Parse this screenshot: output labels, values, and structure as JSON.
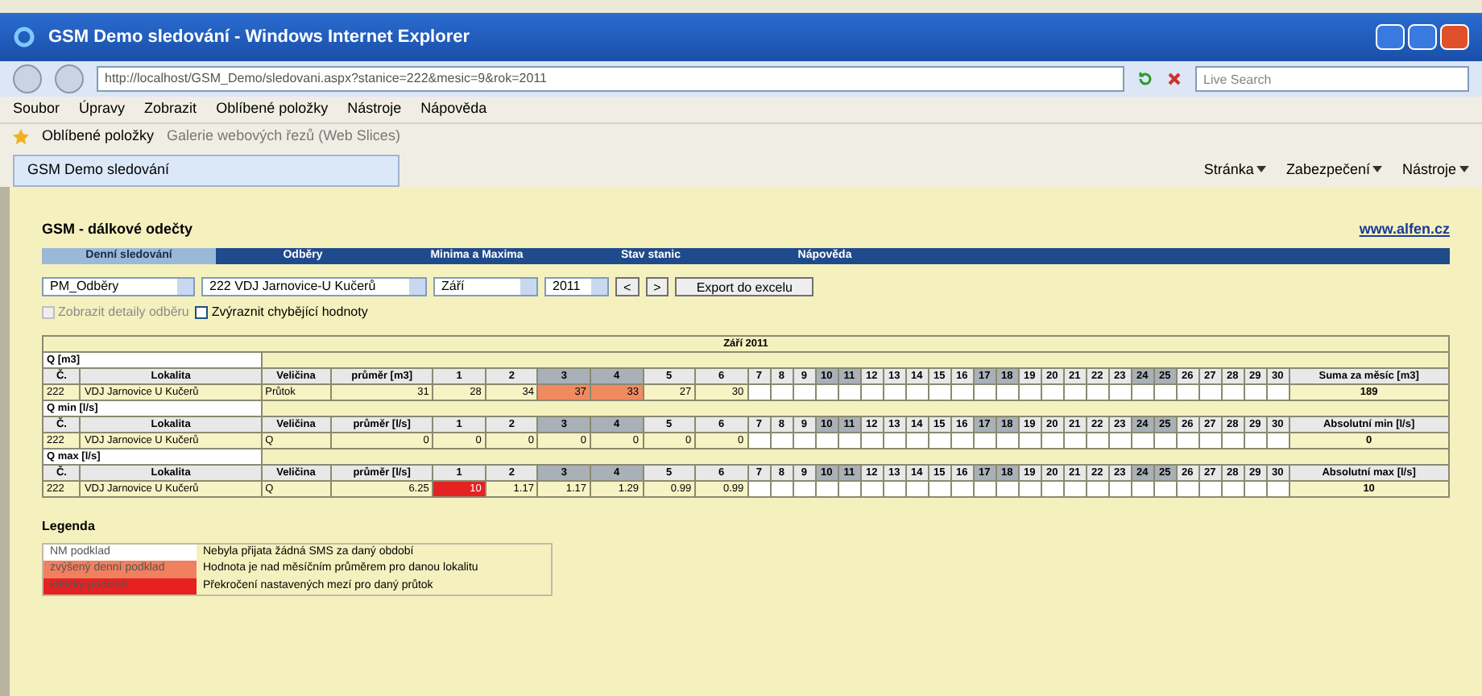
{
  "window": {
    "title": "GSM Demo sledování - Windows Internet Explorer"
  },
  "address_bar": {
    "url": "http://localhost/GSM_Demo/sledovani.aspx?stanice=222&mesic=9&rok=2011"
  },
  "search": {
    "placeholder": "Live Search"
  },
  "menu": [
    "Soubor",
    "Úpravy",
    "Zobrazit",
    "Oblíbené položky",
    "Nástroje",
    "Nápověda"
  ],
  "favorites_bar": {
    "label": "Oblíbené položky",
    "items": [
      "Galerie webových řezů (Web Slices)"
    ]
  },
  "browser_tab": {
    "title": "GSM Demo sledování"
  },
  "command_bar": [
    "Stránka",
    "Zabezpečení",
    "Nástroje"
  ],
  "page": {
    "title": "GSM - dálkové odečty",
    "link": "www.alfen.cz",
    "nav": [
      {
        "label": "Denní sledování",
        "selected": true
      },
      {
        "label": "Odběry",
        "selected": false
      },
      {
        "label": "Minima a Maxima",
        "selected": false
      },
      {
        "label": "Stav stanic",
        "selected": false
      },
      {
        "label": "Nápověda",
        "selected": false
      }
    ],
    "filters": [
      {
        "value": "PM_Odběry"
      },
      {
        "value": "222 VDJ Jarnovice-U Kučerů"
      },
      {
        "value": "Září"
      },
      {
        "value": "2011"
      }
    ],
    "prev_button": "<",
    "next_button": ">",
    "export_button": "Export do excelu",
    "options": [
      {
        "label": "Zobrazit detaily odběru",
        "checked": false,
        "disabled": true
      },
      {
        "label": "Zvýraznit chybějící hodnoty",
        "checked": false,
        "disabled": false
      }
    ],
    "table": {
      "caption": "Září 2011",
      "sections": [
        {
          "title": "Q [m3]",
          "columns": [
            "Č.",
            "Lokalita",
            "Veličina",
            "průměr [m3]"
          ],
          "total_header": "Suma za měsíc [m3]",
          "days": [
            {
              "label": "1",
              "weekend": false
            },
            {
              "label": "2",
              "weekend": false
            },
            {
              "label": "3",
              "weekend": true
            },
            {
              "label": "4",
              "weekend": true
            },
            {
              "label": "5",
              "weekend": false
            },
            {
              "label": "6",
              "weekend": false
            },
            {
              "label": "7",
              "weekend": false
            },
            {
              "label": "8",
              "weekend": false
            },
            {
              "label": "9",
              "weekend": false
            },
            {
              "label": "10",
              "weekend": true
            },
            {
              "label": "11",
              "weekend": true
            },
            {
              "label": "12",
              "weekend": false
            },
            {
              "label": "13",
              "weekend": false
            },
            {
              "label": "14",
              "weekend": false
            },
            {
              "label": "15",
              "weekend": false
            },
            {
              "label": "16",
              "weekend": false
            },
            {
              "label": "17",
              "weekend": true
            },
            {
              "label": "18",
              "weekend": true
            },
            {
              "label": "19",
              "weekend": false
            },
            {
              "label": "20",
              "weekend": false
            },
            {
              "label": "21",
              "weekend": false
            },
            {
              "label": "22",
              "weekend": false
            },
            {
              "label": "23",
              "weekend": false
            },
            {
              "label": "24",
              "weekend": true
            },
            {
              "label": "25",
              "weekend": true
            },
            {
              "label": "26",
              "weekend": false
            },
            {
              "label": "27",
              "weekend": false
            },
            {
              "label": "28",
              "weekend": false
            },
            {
              "label": "29",
              "weekend": false
            },
            {
              "label": "30",
              "weekend": false
            }
          ],
          "row": {
            "number": "222",
            "location": "VDJ Jarnovice U Kučerů",
            "quantity": "Průtok",
            "average": "31",
            "values": [
              {
                "text": "28",
                "high": false,
                "critical": false
              },
              {
                "text": "34",
                "high": false,
                "critical": false
              },
              {
                "text": "37",
                "high": true,
                "critical": false
              },
              {
                "text": "33",
                "high": true,
                "critical": false
              },
              {
                "text": "27",
                "high": false,
                "critical": false
              },
              {
                "text": "30",
                "high": false,
                "critical": false
              }
            ],
            "total": "189"
          }
        },
        {
          "title": "Q min [l/s]",
          "columns": [
            "Č.",
            "Lokalita",
            "Veličina",
            "průměr [l/s]"
          ],
          "total_header": "Absolutní min [l/s]",
          "days": [
            {
              "label": "1",
              "weekend": false
            },
            {
              "label": "2",
              "weekend": false
            },
            {
              "label": "3",
              "weekend": true
            },
            {
              "label": "4",
              "weekend": true
            },
            {
              "label": "5",
              "weekend": false
            },
            {
              "label": "6",
              "weekend": false
            },
            {
              "label": "7",
              "weekend": false
            },
            {
              "label": "8",
              "weekend": false
            },
            {
              "label": "9",
              "weekend": false
            },
            {
              "label": "10",
              "weekend": true
            },
            {
              "label": "11",
              "weekend": true
            },
            {
              "label": "12",
              "weekend": false
            },
            {
              "label": "13",
              "weekend": false
            },
            {
              "label": "14",
              "weekend": false
            },
            {
              "label": "15",
              "weekend": false
            },
            {
              "label": "16",
              "weekend": false
            },
            {
              "label": "17",
              "weekend": true
            },
            {
              "label": "18",
              "weekend": true
            },
            {
              "label": "19",
              "weekend": false
            },
            {
              "label": "20",
              "weekend": false
            },
            {
              "label": "21",
              "weekend": false
            },
            {
              "label": "22",
              "weekend": false
            },
            {
              "label": "23",
              "weekend": false
            },
            {
              "label": "24",
              "weekend": true
            },
            {
              "label": "25",
              "weekend": true
            },
            {
              "label": "26",
              "weekend": false
            },
            {
              "label": "27",
              "weekend": false
            },
            {
              "label": "28",
              "weekend": false
            },
            {
              "label": "29",
              "weekend": false
            },
            {
              "label": "30",
              "weekend": false
            }
          ],
          "row": {
            "number": "222",
            "location": "VDJ Jarnovice U Kučerů",
            "quantity": "Q",
            "average": "0",
            "values": [
              {
                "text": "0",
                "high": false,
                "critical": false
              },
              {
                "text": "0",
                "high": false,
                "critical": false
              },
              {
                "text": "0",
                "high": false,
                "critical": false
              },
              {
                "text": "0",
                "high": false,
                "critical": false
              },
              {
                "text": "0",
                "high": false,
                "critical": false
              },
              {
                "text": "0",
                "high": false,
                "critical": false
              }
            ],
            "total": "0"
          }
        },
        {
          "title": "Q max [l/s]",
          "columns": [
            "Č.",
            "Lokalita",
            "Veličina",
            "průměr [l/s]"
          ],
          "total_header": "Absolutní max [l/s]",
          "days": [
            {
              "label": "1",
              "weekend": false
            },
            {
              "label": "2",
              "weekend": false
            },
            {
              "label": "3",
              "weekend": true
            },
            {
              "label": "4",
              "weekend": true
            },
            {
              "label": "5",
              "weekend": false
            },
            {
              "label": "6",
              "weekend": false
            },
            {
              "label": "7",
              "weekend": false
            },
            {
              "label": "8",
              "weekend": false
            },
            {
              "label": "9",
              "weekend": false
            },
            {
              "label": "10",
              "weekend": true
            },
            {
              "label": "11",
              "weekend": true
            },
            {
              "label": "12",
              "weekend": false
            },
            {
              "label": "13",
              "weekend": false
            },
            {
              "label": "14",
              "weekend": false
            },
            {
              "label": "15",
              "weekend": false
            },
            {
              "label": "16",
              "weekend": false
            },
            {
              "label": "17",
              "weekend": true
            },
            {
              "label": "18",
              "weekend": true
            },
            {
              "label": "19",
              "weekend": false
            },
            {
              "label": "20",
              "weekend": false
            },
            {
              "label": "21",
              "weekend": false
            },
            {
              "label": "22",
              "weekend": false
            },
            {
              "label": "23",
              "weekend": false
            },
            {
              "label": "24",
              "weekend": true
            },
            {
              "label": "25",
              "weekend": true
            },
            {
              "label": "26",
              "weekend": false
            },
            {
              "label": "27",
              "weekend": false
            },
            {
              "label": "28",
              "weekend": false
            },
            {
              "label": "29",
              "weekend": false
            },
            {
              "label": "30",
              "weekend": false
            }
          ],
          "row": {
            "number": "222",
            "location": "VDJ Jarnovice U Kučerů",
            "quantity": "Q",
            "average": "6.25",
            "values": [
              {
                "text": "10",
                "high": false,
                "critical": true
              },
              {
                "text": "1.17",
                "high": false,
                "critical": false
              },
              {
                "text": "1.17",
                "high": false,
                "critical": false
              },
              {
                "text": "1.29",
                "high": false,
                "critical": false
              },
              {
                "text": "0.99",
                "high": false,
                "critical": false
              },
              {
                "text": "0.99",
                "high": false,
                "critical": false
              }
            ],
            "total": "10"
          }
        }
      ]
    },
    "legend": {
      "title": "Legenda",
      "items": [
        {
          "label": "NM podklad",
          "color": "#ffffff",
          "description": "Nebyla přijata žádná SMS za daný období"
        },
        {
          "label": "zvýšený denní podklad",
          "color": "#f08060",
          "description": "Hodnota je nad měsíčním průměrem pro danou lokalitu"
        },
        {
          "label": "kritický podklad",
          "color": "#e82020",
          "description": "Překročení nastavených mezí pro daný průtok"
        }
      ]
    }
  }
}
